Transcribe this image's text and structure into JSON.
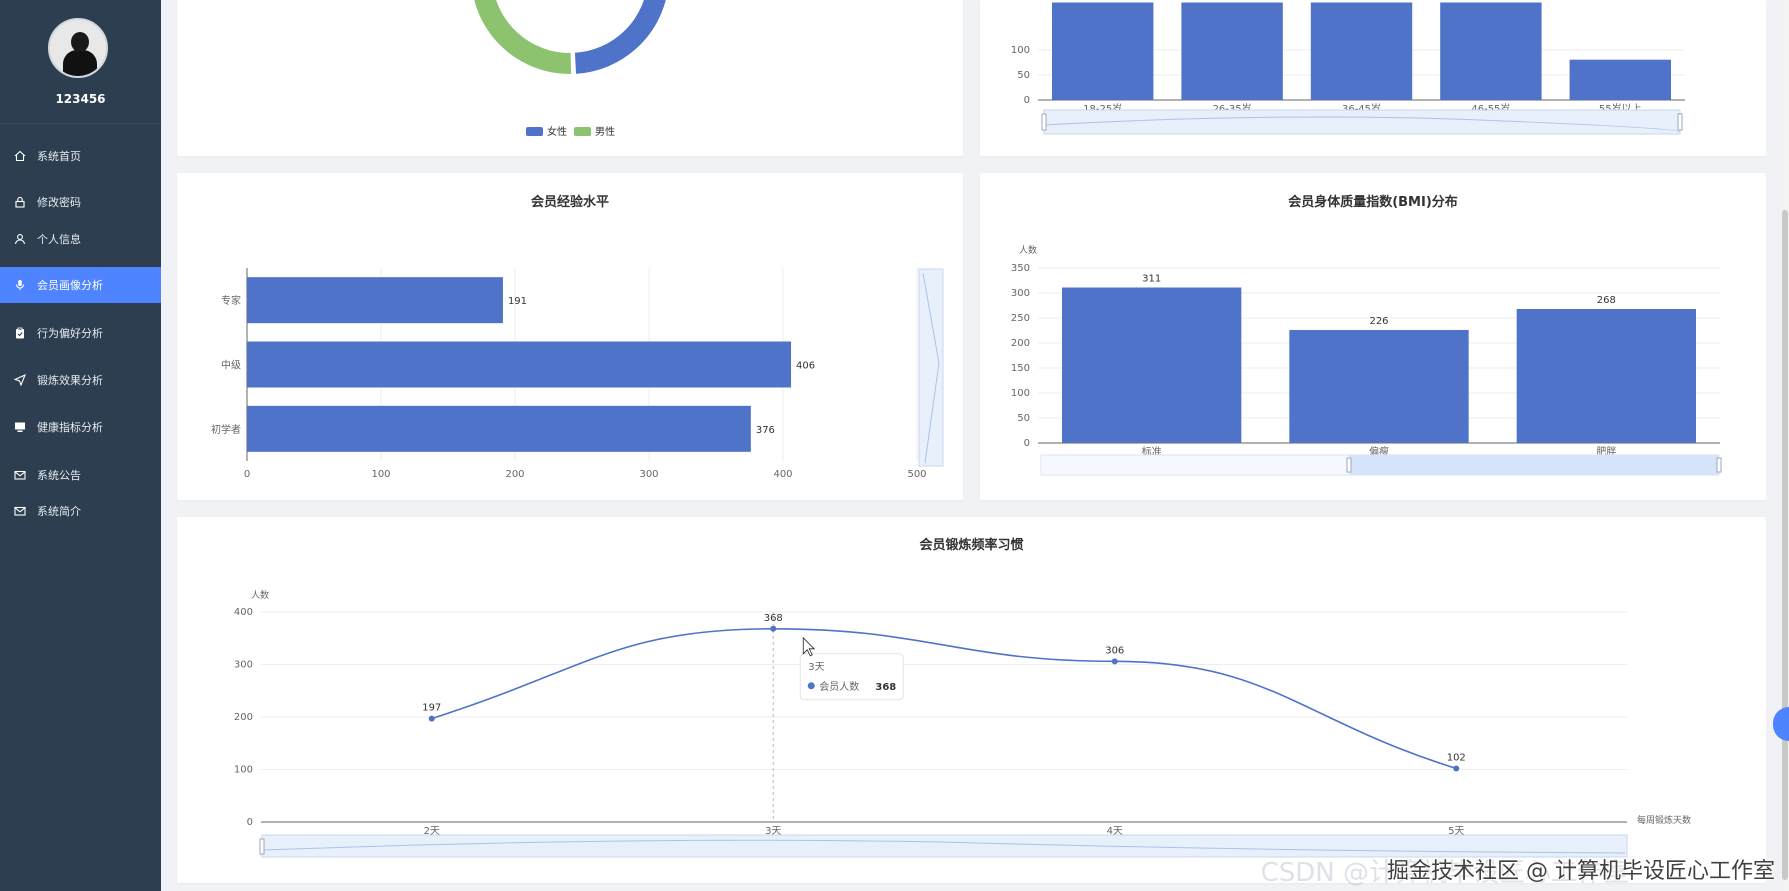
{
  "user": {
    "name": "123456"
  },
  "nav": [
    {
      "label": "系统首页",
      "icon": "home-icon"
    },
    {
      "label": "修改密码",
      "icon": "lock-icon"
    },
    {
      "label": "个人信息",
      "icon": "user-icon"
    },
    {
      "label": "会员画像分析",
      "icon": "microphone-icon",
      "active": true
    },
    {
      "label": "行为偏好分析",
      "icon": "clipboard-icon"
    },
    {
      "label": "锻炼效果分析",
      "icon": "send-icon"
    },
    {
      "label": "健康指标分析",
      "icon": "monitor-icon"
    },
    {
      "label": "系统公告",
      "icon": "mail-icon"
    },
    {
      "label": "系统简介",
      "icon": "mail-icon"
    }
  ],
  "colors": {
    "series": "#4e73c8",
    "accent": "#4e84ff",
    "female": "#4e73c8",
    "male": "#8dc26f",
    "sidebar": "#2c3e50"
  },
  "watermark": {
    "main": "掘金技术社区 @ 计算机毕设匠心工作室",
    "sub": "CSDN @计算机毕设匠心工作室"
  },
  "charts": {
    "gender": {
      "chart_data": {
        "type": "pie",
        "legend": [
          "女性",
          "男性"
        ],
        "legend_position": "bottom"
      }
    },
    "age": {
      "chart_data": {
        "type": "bar",
        "categories": [
          "18-25岁",
          "26-35岁",
          "36-45岁",
          "46-55岁",
          "55岁以上"
        ],
        "yticks": [
          "100",
          "50",
          "0"
        ],
        "ylim": [
          0,
          150
        ]
      }
    },
    "experience": {
      "chart_data": {
        "type": "bar",
        "orientation": "horizontal",
        "title": "会员经验水平",
        "categories": [
          "专家",
          "中级",
          "初学者"
        ],
        "values": [
          191,
          406,
          376
        ],
        "xticks": [
          "0",
          "100",
          "200",
          "300",
          "400",
          "500"
        ],
        "xlim": [
          0,
          500
        ],
        "grid": true
      }
    },
    "bmi": {
      "chart_data": {
        "type": "bar",
        "title": "会员身体质量指数(BMI)分布",
        "ylabel": "人数",
        "categories": [
          "标准",
          "偏瘦",
          "肥胖"
        ],
        "values": [
          311,
          226,
          268
        ],
        "yticks": [
          "350",
          "300",
          "250",
          "200",
          "150",
          "100",
          "50",
          "0"
        ],
        "ylim": [
          0,
          350
        ],
        "grid": true
      }
    },
    "frequency": {
      "chart_data": {
        "type": "line",
        "title": "会员锻炼频率习惯",
        "ylabel": "人数",
        "xlabel": "每周锻炼天数",
        "categories": [
          "2天",
          "3天",
          "4天",
          "5天"
        ],
        "series": [
          {
            "name": "会员人数",
            "values": [
              197,
              368,
              306,
              102
            ]
          }
        ],
        "yticks": [
          "400",
          "300",
          "200",
          "100",
          "0"
        ],
        "ylim": [
          0,
          400
        ],
        "grid": true,
        "tooltip": {
          "title": "3天",
          "label": "会员人数",
          "value": "368"
        }
      }
    }
  }
}
